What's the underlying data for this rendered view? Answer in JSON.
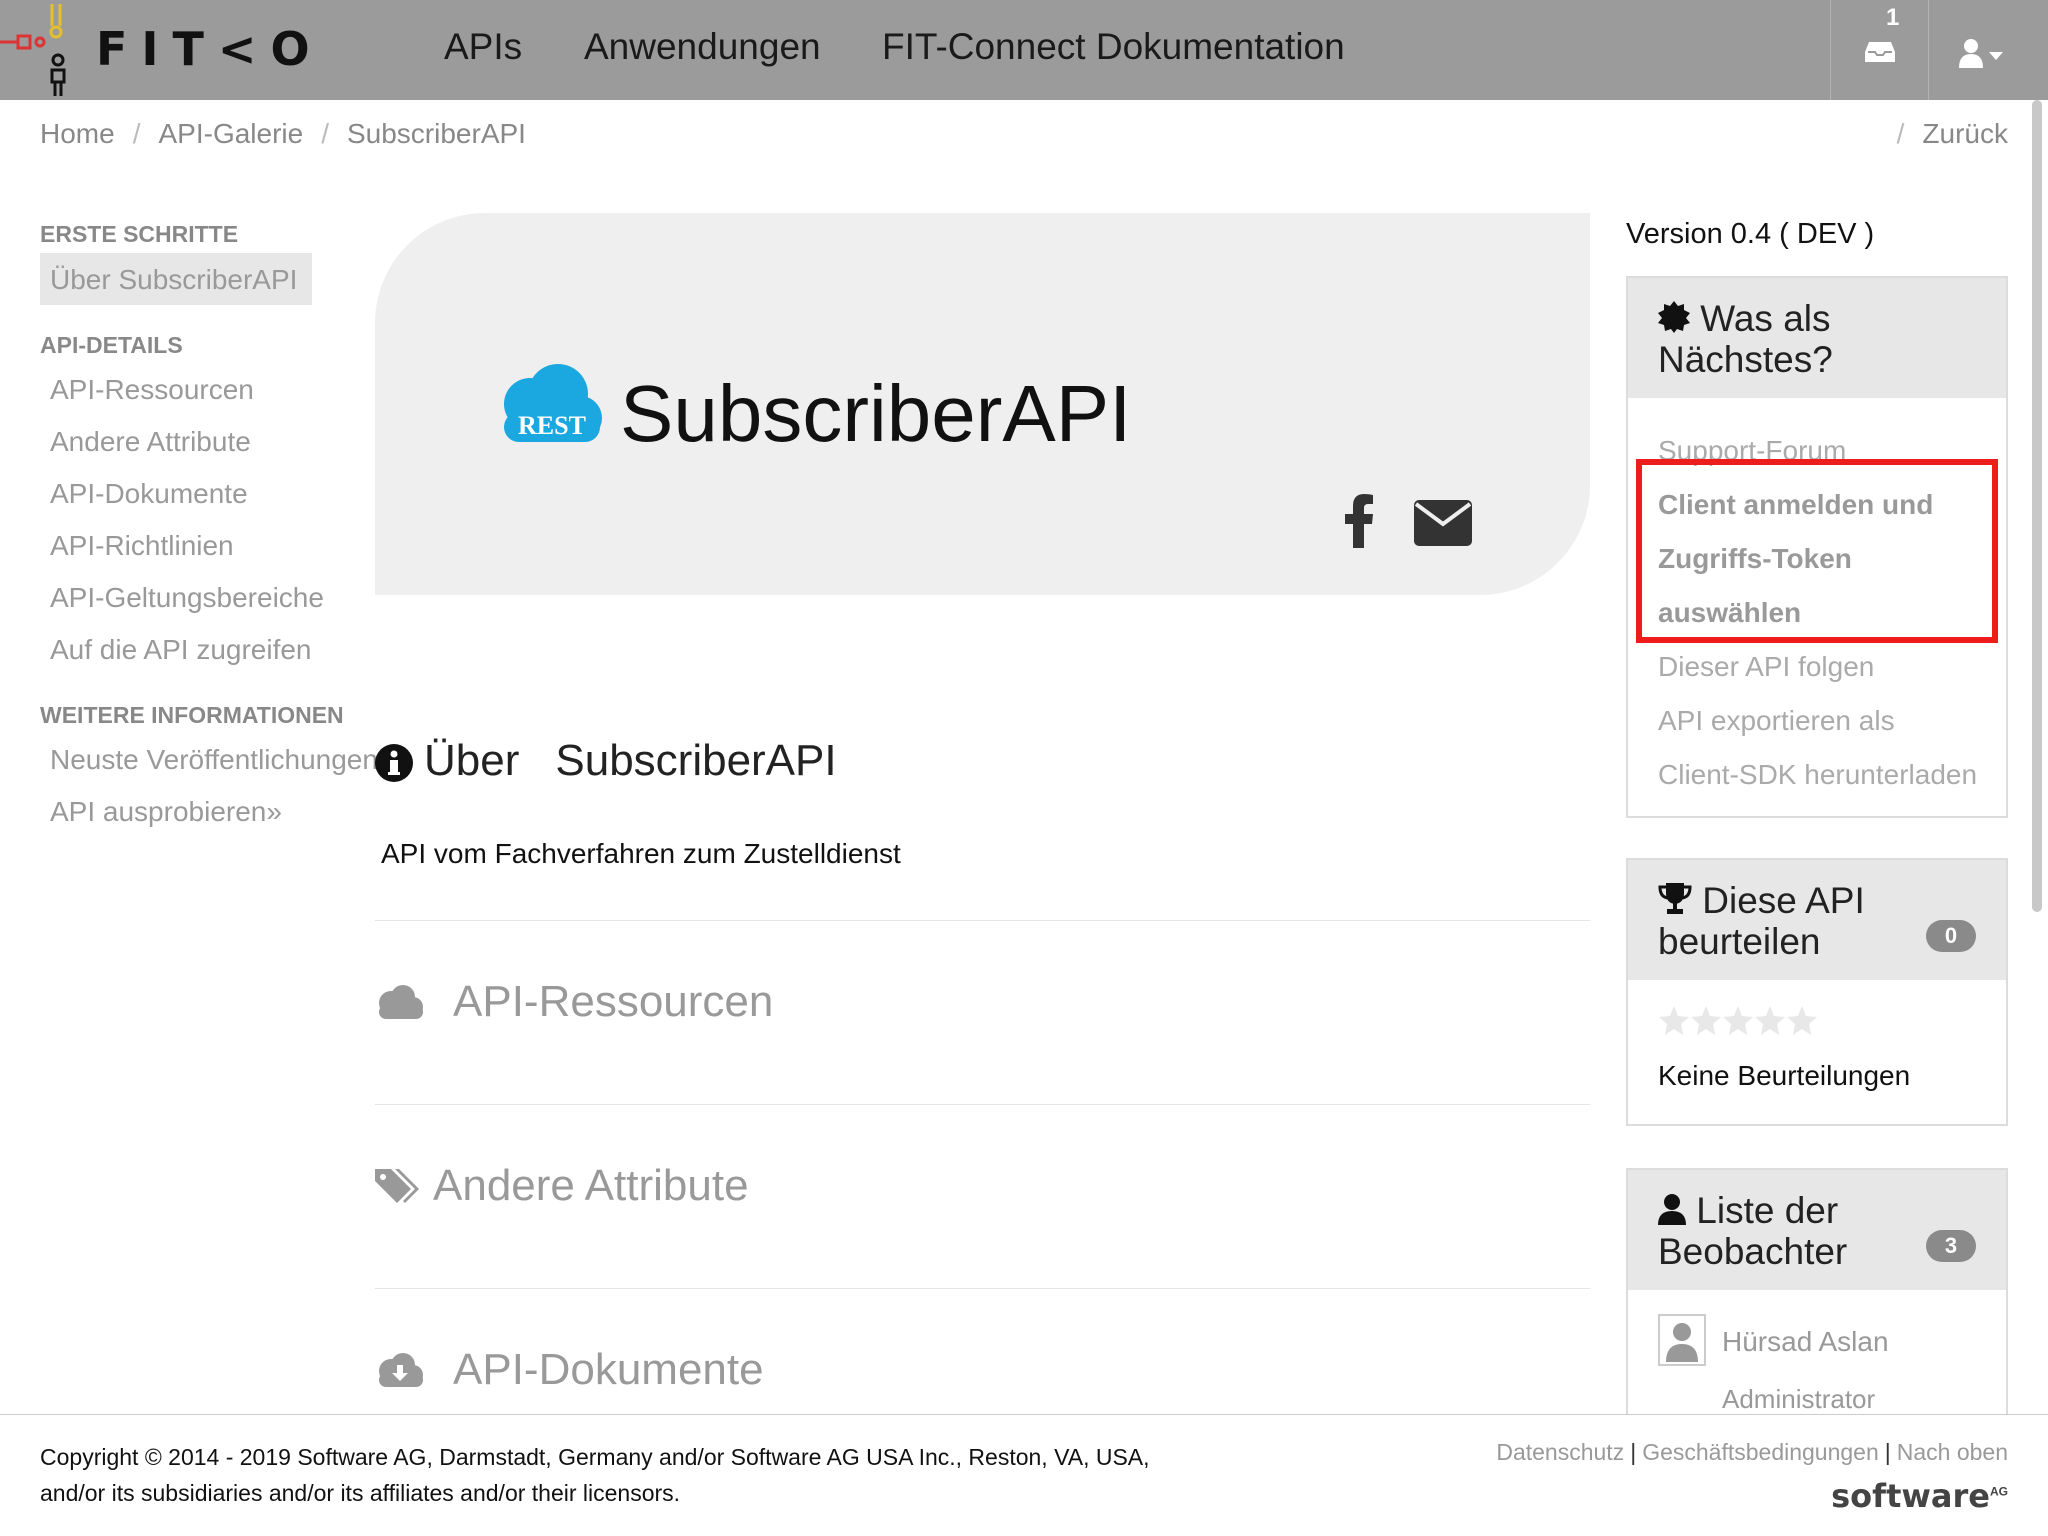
{
  "navbar": {
    "logo_text": "FIT<O",
    "links": [
      "APIs",
      "Anwendungen",
      "FIT-Connect Dokumentation"
    ],
    "inbox_count": "1"
  },
  "breadcrumb": {
    "items": [
      "Home",
      "API-Galerie",
      "SubscriberAPI"
    ],
    "back": "Zurück"
  },
  "sidebar": {
    "sections": [
      {
        "title": "ERSTE SCHRITTE",
        "items": [
          "Über SubscriberAPI"
        ]
      },
      {
        "title": "API-DETAILS",
        "items": [
          "API-Ressourcen",
          "Andere Attribute",
          "API-Dokumente",
          "API-Richtlinien",
          "API-Geltungsbereiche",
          "Auf die API zugreifen"
        ]
      },
      {
        "title": "WEITERE INFORMATIONEN",
        "items": [
          "Neuste Veröffentlichungen",
          "API ausprobieren»"
        ]
      }
    ]
  },
  "hero": {
    "badge": "REST",
    "title": "SubscriberAPI"
  },
  "about": {
    "title_prefix": "Über",
    "title_name": "SubscriberAPI",
    "description": "API vom Fachverfahren zum Zustelldienst"
  },
  "sections": [
    "API-Ressourcen",
    "Andere Attribute",
    "API-Dokumente"
  ],
  "right": {
    "version": "Version 0.4 ( DEV )",
    "next": {
      "title_line1": "Was als",
      "title_line2": "Nächstes?",
      "links": [
        "Support-Forum",
        "Client anmelden und",
        "Zugriffs-Token",
        "auswählen",
        "Dieser API folgen",
        "API exportieren als",
        "Client-SDK herunterladen"
      ]
    },
    "rate": {
      "title_line1": "Diese API",
      "title_line2": "beurteilen",
      "count": "0",
      "rating": 0,
      "no_ratings": "Keine Beurteilungen"
    },
    "watchers": {
      "title_line1": "Liste der",
      "title_line2": "Beobachter",
      "count": "3",
      "user_name": "Hürsad Aslan",
      "user_role": "Administrator"
    }
  },
  "footer": {
    "copyright_line1": "Copyright © 2014 - 2019 Software AG, Darmstadt, Germany and/or Software AG USA Inc., Reston, VA, USA,",
    "copyright_line2": "and/or its subsidiaries and/or its affiliates and/or their licensors.",
    "links": [
      "Datenschutz",
      "Geschäftsbedingungen",
      "Nach oben"
    ],
    "brand": "software",
    "brand_suffix": "AG"
  },
  "colors": {
    "navbar": "#9b9b9b",
    "highlight": "#ee1d1d",
    "rest_blue": "#1ba7e0"
  }
}
